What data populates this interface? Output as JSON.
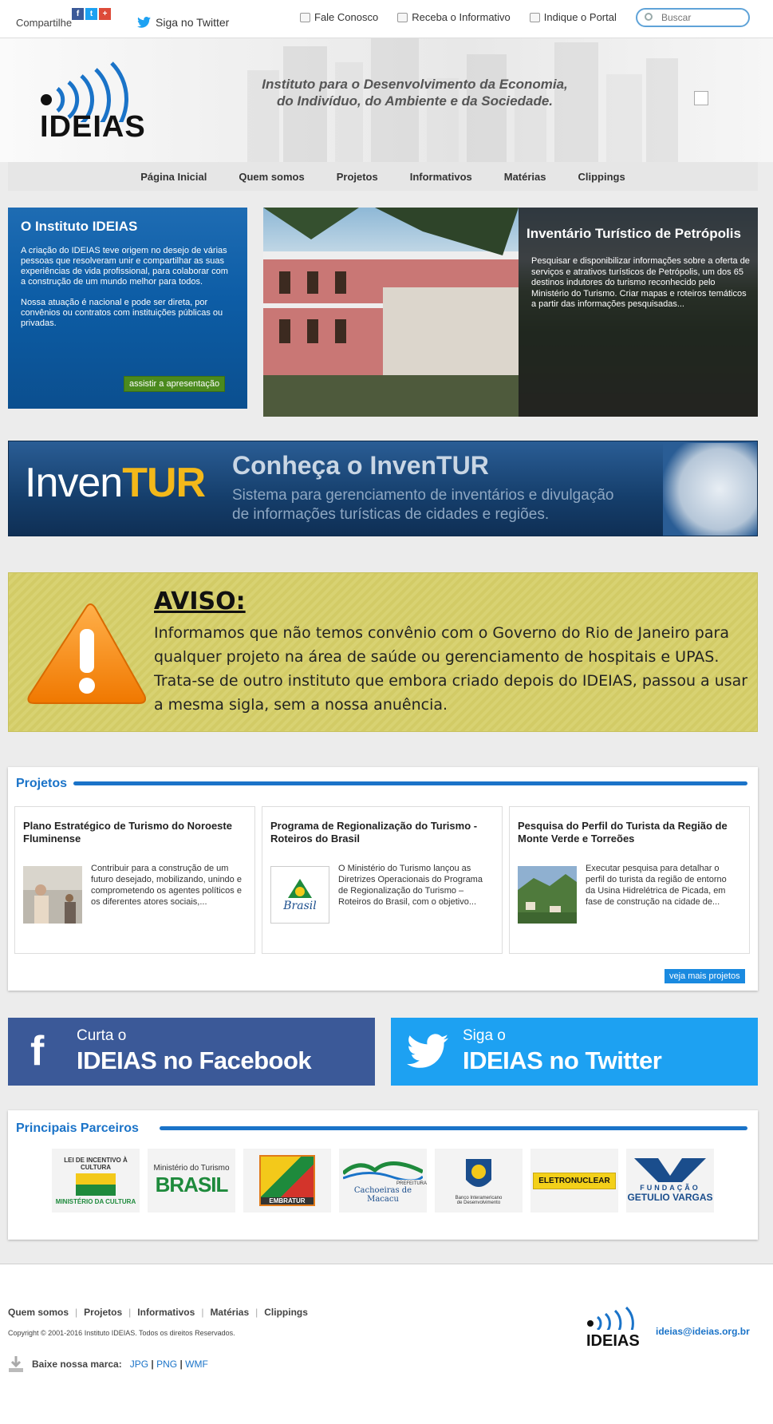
{
  "topbar": {
    "share_label": "Compartilhe",
    "share_icons": [
      "facebook-icon",
      "twitter-icon",
      "googleplus-icon"
    ],
    "twitter_label": "Siga no Twitter",
    "links": [
      {
        "label": "Fale Conosco",
        "icon": "speech-bubble-icon"
      },
      {
        "label": "Receba o Informativo",
        "icon": "document-icon"
      },
      {
        "label": "Indique o Portal",
        "icon": "share-document-icon"
      }
    ],
    "search_placeholder": "Buscar"
  },
  "header": {
    "logo_text": "IDEIAS",
    "tagline_1": "Instituto para o Desenvolvimento da Economia,",
    "tagline_2": "do Indivíduo, do Ambiente e da Sociedade."
  },
  "nav": [
    "Página Inicial",
    "Quem somos",
    "Projetos",
    "Informativos",
    "Matérias",
    "Clippings"
  ],
  "intro": {
    "title": "O Instituto IDEIAS",
    "p1": "A criação do IDEIAS teve origem no desejo de várias pessoas que resolveram unir e compartilhar as suas experiências de vida profissional, para colaborar com a construção de um mundo melhor para todos.",
    "p2": "Nossa atuação é nacional e pode ser direta, por convênios ou contratos com instituições públicas ou privadas.",
    "button": "assistir a apresentação"
  },
  "feature": {
    "title": "Inventário Turístico de Petrópolis",
    "text": "Pesquisar e disponibilizar informações sobre a oferta de serviços e atrativos turísticos de Petrópolis, um dos 65 destinos indutores do turismo reconhecido pelo Ministério do Turismo. Criar mapas e roteiros temáticos a partir das informações pesquisadas..."
  },
  "inventur": {
    "logo_a": "Inven",
    "logo_b": "TUR",
    "title": "Conheça o InvenTUR",
    "sub_1": "Sistema para gerenciamento de inventários e divulgação",
    "sub_2": "de informações turísticas de cidades e regiões."
  },
  "aviso": {
    "title": "AVISO:",
    "text": "Informamos que não temos convênio com o Governo do Rio de Janeiro para qualquer projeto na área de saúde ou gerenciamento de hospitais e UPAS. Trata-se de outro instituto que embora criado depois do IDEIAS, passou a usar a mesma sigla, sem a nossa anuência."
  },
  "projetos": {
    "title": "Projetos",
    "items": [
      {
        "title": "Plano Estratégico de Turismo do Noroeste Fluminense",
        "text": "Contribuir para a construção de um futuro desejado, mobilizando, unindo e comprometendo os agentes políticos e os diferentes atores sociais,..."
      },
      {
        "title": "Programa de Regionalização do Turismo - Roteiros do Brasil",
        "text": "O Ministério do Turismo lançou as Diretrizes Operacionais do Programa de Regionalização do Turismo – Roteiros do Brasil, com o objetivo..."
      },
      {
        "title": "Pesquisa do Perfil do Turista da Região de Monte Verde e Torreões",
        "text": "Executar pesquisa para detalhar o perfil do turista da região de entorno da Usina Hidrelétrica de Picada, em fase de construção na cidade de..."
      }
    ],
    "thumb_2_text": "Brasil",
    "more_button": "veja mais projetos"
  },
  "social": {
    "facebook_small": "Curta o",
    "facebook_big": "IDEIAS no Facebook",
    "twitter_small": "Siga o",
    "twitter_big": "IDEIAS no Twitter"
  },
  "parceiros": {
    "title": "Principais Parceiros",
    "items": [
      {
        "line1": "LEI DE INCENTIVO À CULTURA",
        "line2": "MINISTÉRIO DA CULTURA"
      },
      {
        "line1": "Ministério do Turismo",
        "line2": "BRASIL"
      },
      {
        "line1": "",
        "line2": "EMBRATUR"
      },
      {
        "line1": "PREFEITURA",
        "line2": "Cachoeiras de Macacu"
      },
      {
        "line1": "Banco Interamericano",
        "line2": "de Desenvolvimento"
      },
      {
        "line1": "",
        "line2": "ELETRONUCLEAR"
      },
      {
        "line1": "FUNDAÇÃO",
        "line2": "GETULIO VARGAS"
      }
    ]
  },
  "footer": {
    "links": [
      "Quem somos",
      "Projetos",
      "Informativos",
      "Matérias",
      "Clippings"
    ],
    "copyright": "Copyright © 2001-2016 Instituto IDEIAS. Todos os direitos Reservados.",
    "brand_label": "Baixe nossa marca:",
    "brand_formats": [
      "JPG",
      "PNG",
      "WMF"
    ],
    "email": "ideias@ideias.org.br",
    "logo_text": "IDEIAS"
  },
  "colors": {
    "accent": "#1a73c8",
    "facebook": "#3b5998",
    "twitter": "#1da1f2",
    "green_button": "#4b8a1e"
  }
}
